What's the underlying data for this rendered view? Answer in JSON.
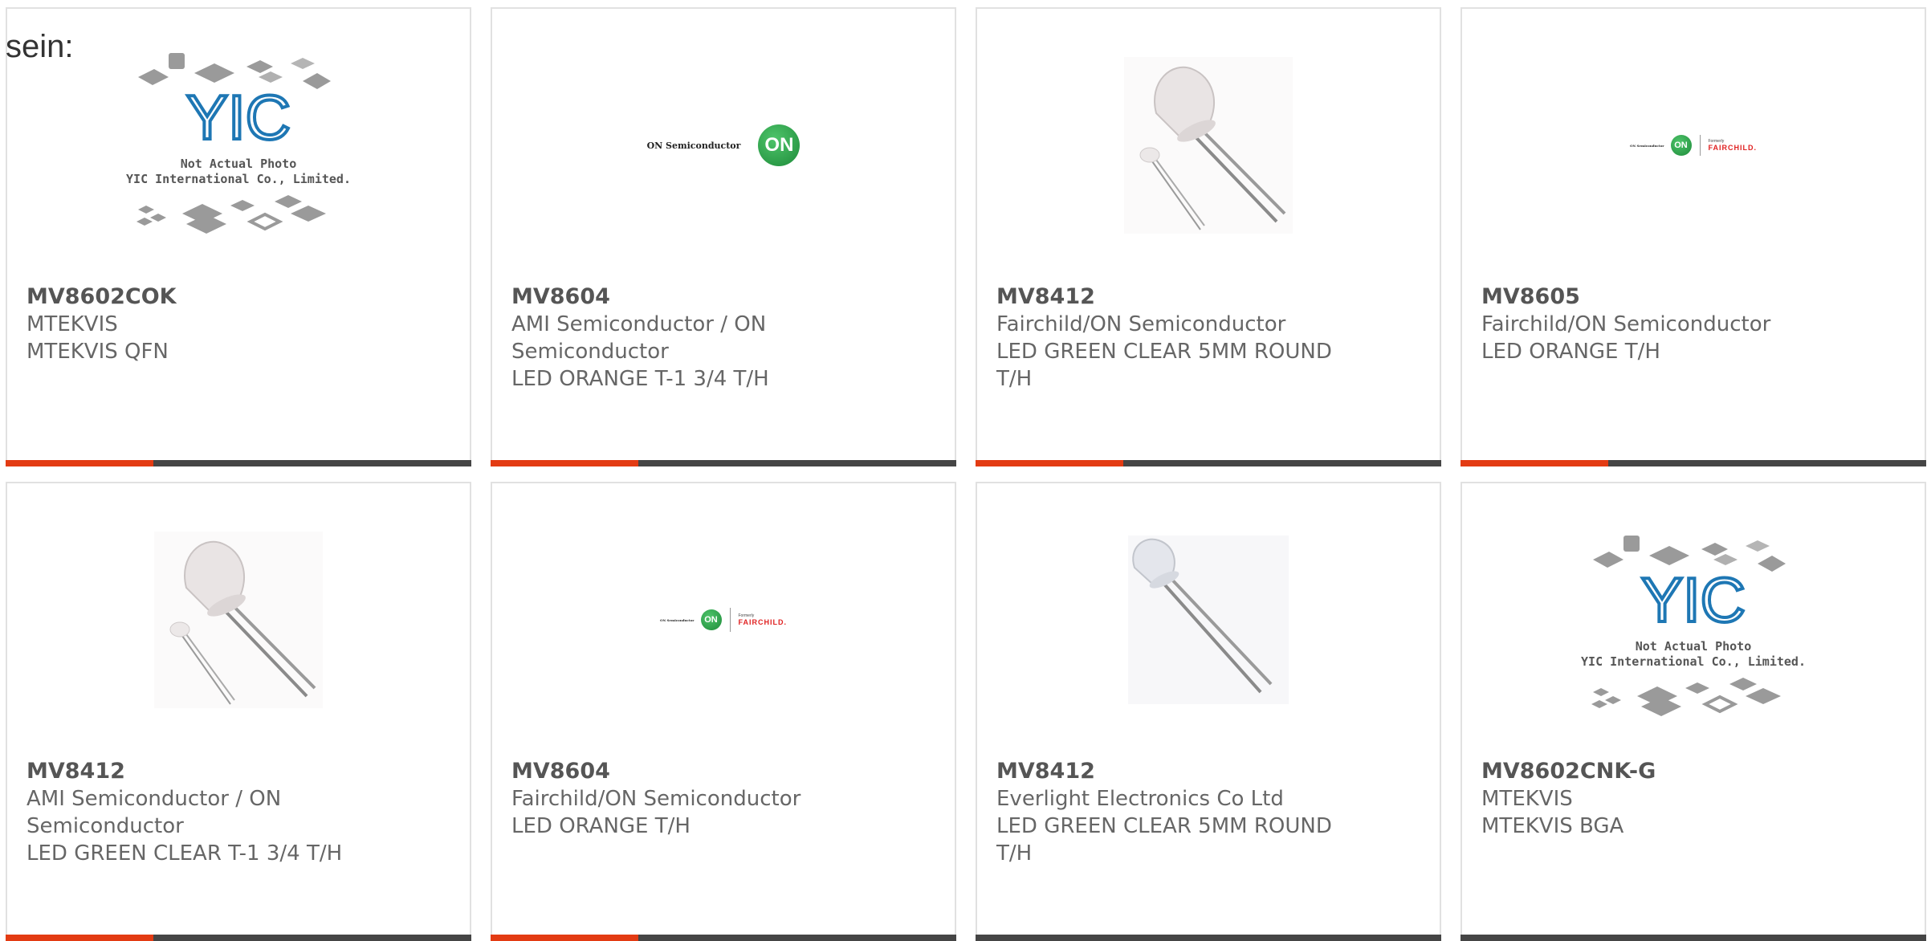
{
  "page": {
    "lead_text": "sein:"
  },
  "brand": {
    "accent": "#e33b13",
    "bar": "#454545",
    "on_green": "#2a9a46",
    "fairchild_red": "#e02222"
  },
  "logos": {
    "on_semiconductor_text": "ON Semiconductor",
    "on_mark": "ON",
    "fairchild_formerly": "Formerly",
    "fairchild_word": "FAIRCHILD.",
    "yic_mark": "YIC",
    "yic_caption_1": "Not Actual Photo",
    "yic_caption_2": "YIC International Co., Limited."
  },
  "products": [
    {
      "part": "MV8602COK",
      "lines": [
        "MTEKVIS",
        "MTEKVIS QFN"
      ],
      "image": "yic-placeholder"
    },
    {
      "part": "MV8604",
      "lines": [
        "AMI Semiconductor / ON",
        "Semiconductor",
        "LED ORANGE T-1 3/4 T/H"
      ],
      "image": "on-semiconductor-logo"
    },
    {
      "part": "MV8412",
      "lines": [
        "Fairchild/ON Semiconductor",
        "LED GREEN CLEAR 5MM ROUND",
        "T/H"
      ],
      "image": "led-photo"
    },
    {
      "part": "MV8605",
      "lines": [
        "Fairchild/ON Semiconductor",
        "LED ORANGE T/H"
      ],
      "image": "on-fairchild-logo"
    },
    {
      "part": "MV8412",
      "lines": [
        "AMI Semiconductor / ON",
        "Semiconductor",
        "LED GREEN CLEAR T-1 3/4 T/H"
      ],
      "image": "led-photo"
    },
    {
      "part": "MV8604",
      "lines": [
        "Fairchild/ON Semiconductor",
        "LED ORANGE T/H"
      ],
      "image": "on-fairchild-logo"
    },
    {
      "part": "MV8412",
      "lines": [
        "Everlight Electronics Co Ltd",
        "LED GREEN CLEAR 5MM ROUND",
        "T/H"
      ],
      "image": "led-photo"
    },
    {
      "part": "MV8602CNK-G",
      "lines": [
        "MTEKVIS",
        "MTEKVIS BGA"
      ],
      "image": "yic-placeholder"
    }
  ]
}
